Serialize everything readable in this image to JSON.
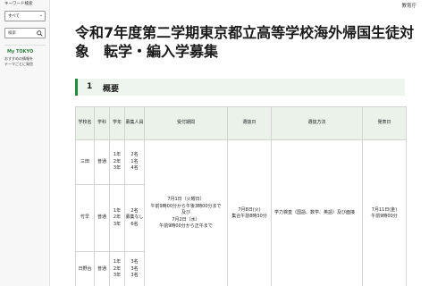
{
  "sidebar": {
    "keyword_label": "キーワード検索",
    "select_value": "すべて",
    "search_placeholder": "検索",
    "mytokyo_title": "My TOKYO",
    "mytokyo_desc_1": "おすすめの情報を",
    "mytokyo_desc_2": "テーマごとに発信"
  },
  "header": {
    "agency": "教育庁"
  },
  "page": {
    "title": "令和7年度第二学期東京都立高等学校海外帰国生徒対象　転学・編入学募集"
  },
  "section": {
    "number": "1",
    "title": "概要"
  },
  "table": {
    "headers": [
      "学校名",
      "学科",
      "学年",
      "募集人員",
      "受付期間",
      "選抜日",
      "選抜方法",
      "発表日"
    ],
    "rows": [
      {
        "school": "三田",
        "dept": "普通",
        "grade": "1年\n2年\n3年",
        "quota": "2名\n1名\n4名"
      },
      {
        "school": "竹早",
        "dept": "普通",
        "grade": "1年\n2年\n3年",
        "quota": "2名\n募集なし\n6名"
      },
      {
        "school": "日野台",
        "dept": "普通",
        "grade": "1年\n2年\n3年",
        "quota": "3名\n3名\n3名"
      }
    ],
    "period": "7月1日（火曜日）\n午前9時00分から午後3時00分まで\n及び\n7月2日（水）\n午前9時00分から正午まで",
    "exam_date": "7月8日(火)\n集合午前8時30分",
    "method": "学力検査（国語、数学、英語）及び面接",
    "announce": "7月11日(金)\n午前9時00分"
  }
}
